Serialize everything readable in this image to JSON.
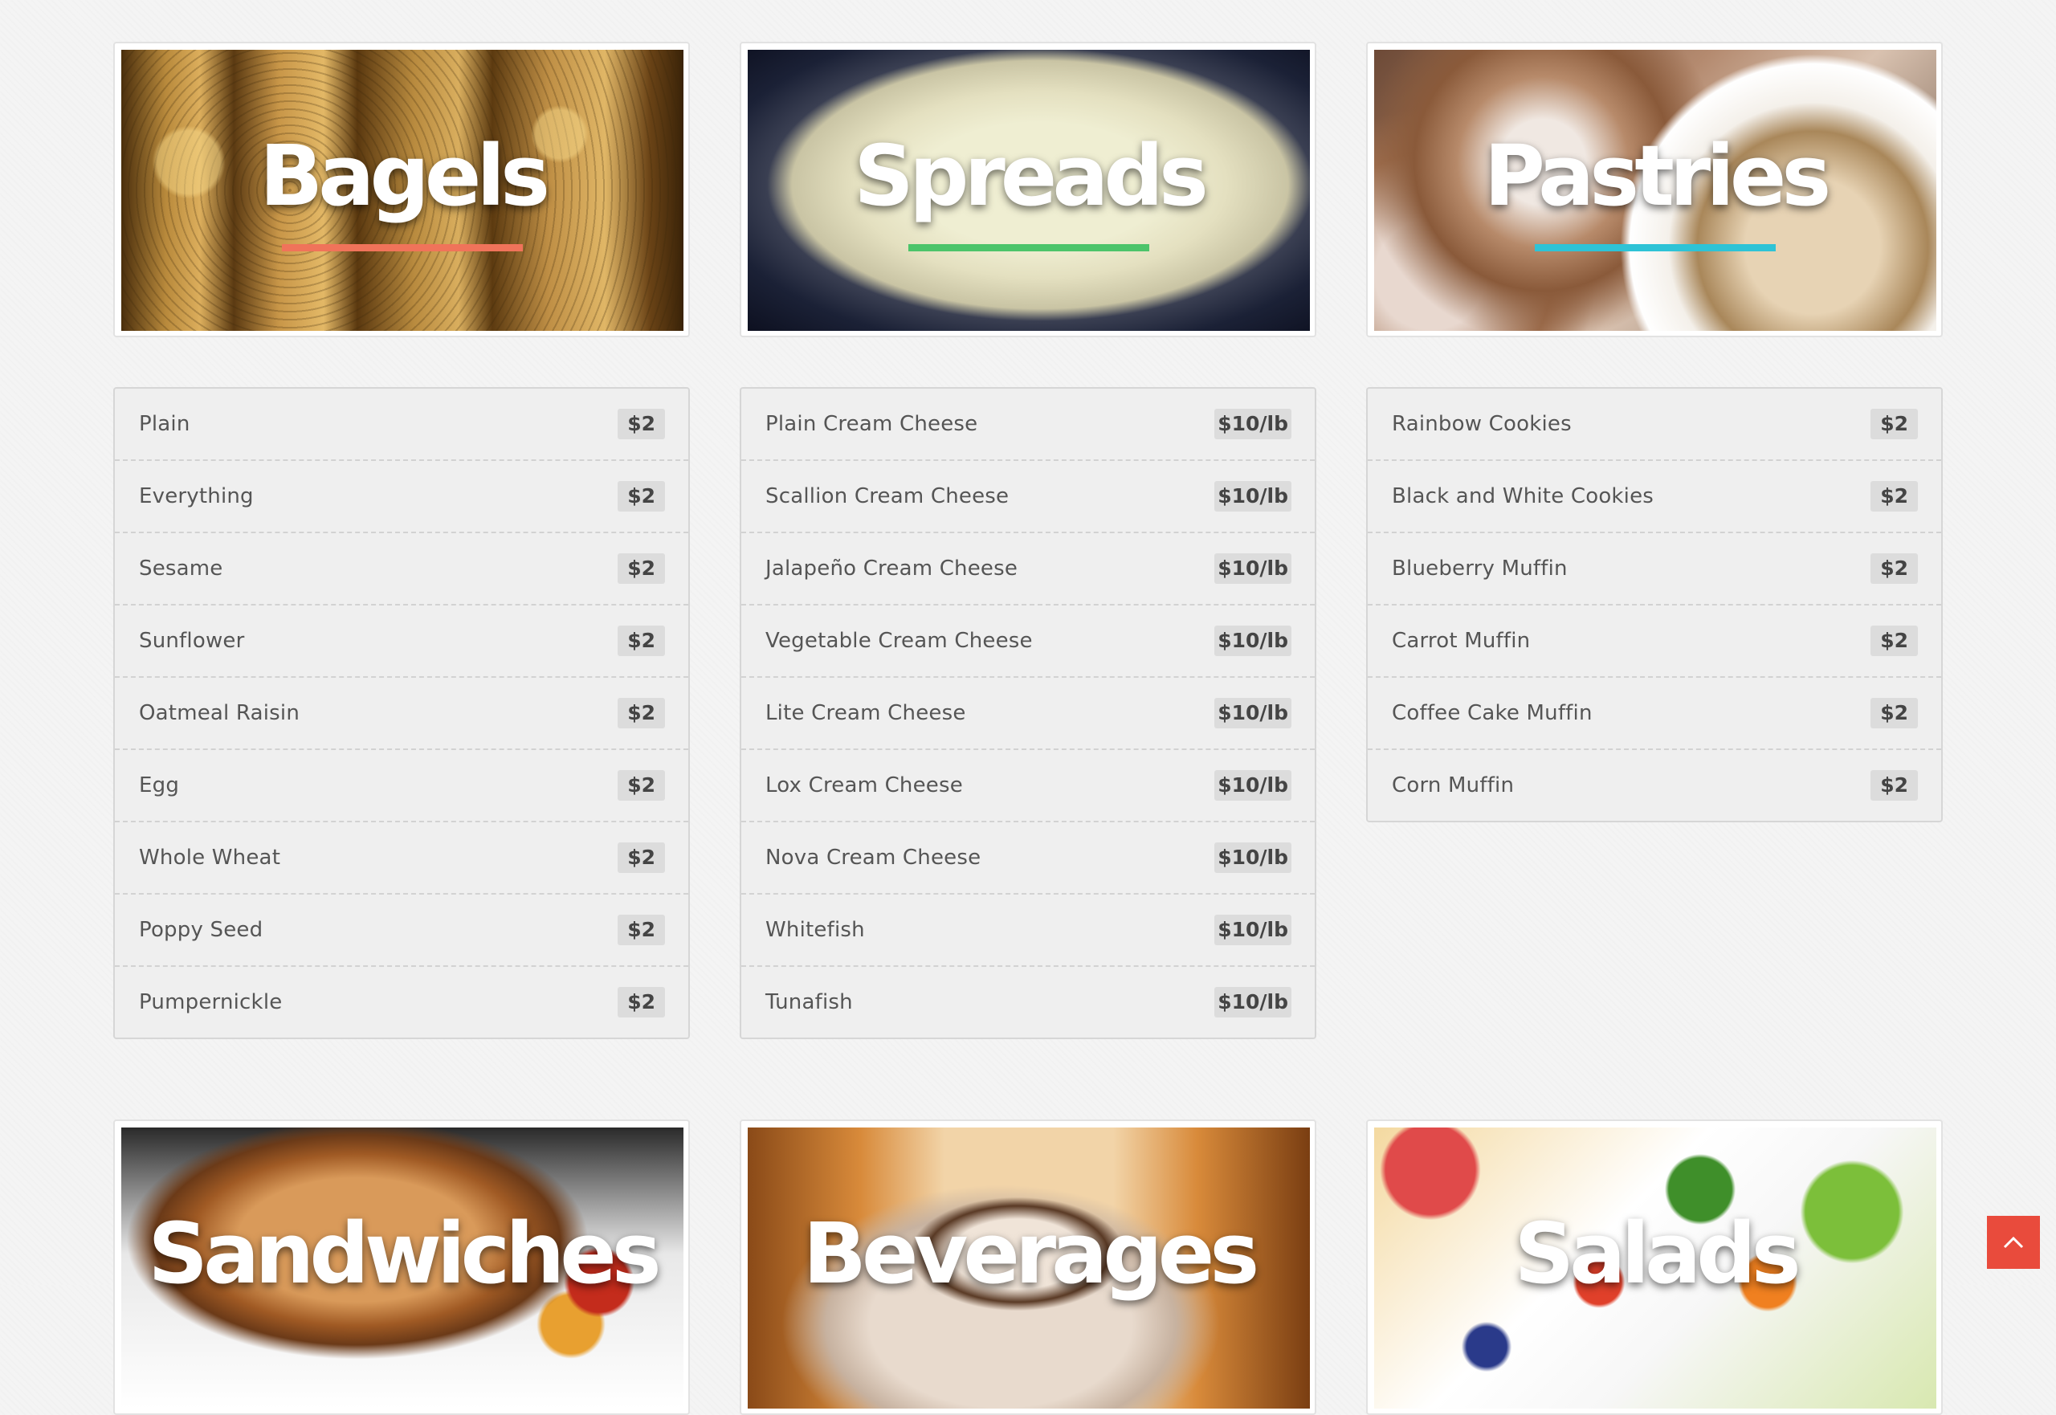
{
  "colors": {
    "bagels_underline": "#f0735a",
    "spreads_underline": "#4cc46a",
    "pastries_underline": "#2ec3d6",
    "scroll_button": "#e94b3c"
  },
  "sections": {
    "bagels": {
      "title": "Bagels",
      "items": [
        {
          "name": "Plain",
          "price": "$2"
        },
        {
          "name": "Everything",
          "price": "$2"
        },
        {
          "name": "Sesame",
          "price": "$2"
        },
        {
          "name": "Sunflower",
          "price": "$2"
        },
        {
          "name": "Oatmeal Raisin",
          "price": "$2"
        },
        {
          "name": "Egg",
          "price": "$2"
        },
        {
          "name": "Whole Wheat",
          "price": "$2"
        },
        {
          "name": "Poppy Seed",
          "price": "$2"
        },
        {
          "name": "Pumpernickle",
          "price": "$2"
        }
      ]
    },
    "spreads": {
      "title": "Spreads",
      "items": [
        {
          "name": "Plain Cream Cheese",
          "price": "$10/lb"
        },
        {
          "name": "Scallion Cream Cheese",
          "price": "$10/lb"
        },
        {
          "name": "Jalapeño Cream Cheese",
          "price": "$10/lb"
        },
        {
          "name": "Vegetable Cream Cheese",
          "price": "$10/lb"
        },
        {
          "name": "Lite Cream Cheese",
          "price": "$10/lb"
        },
        {
          "name": "Lox Cream Cheese",
          "price": "$10/lb"
        },
        {
          "name": "Nova Cream Cheese",
          "price": "$10/lb"
        },
        {
          "name": "Whitefish",
          "price": "$10/lb"
        },
        {
          "name": "Tunafish",
          "price": "$10/lb"
        }
      ]
    },
    "pastries": {
      "title": "Pastries",
      "items": [
        {
          "name": "Rainbow Cookies",
          "price": "$2"
        },
        {
          "name": "Black and White Cookies",
          "price": "$2"
        },
        {
          "name": "Blueberry Muffin",
          "price": "$2"
        },
        {
          "name": "Carrot Muffin",
          "price": "$2"
        },
        {
          "name": "Coffee Cake Muffin",
          "price": "$2"
        },
        {
          "name": "Corn Muffin",
          "price": "$2"
        }
      ]
    },
    "sandwiches": {
      "title": "Sandwiches"
    },
    "beverages": {
      "title": "Beverages"
    },
    "salads": {
      "title": "Salads"
    }
  },
  "scroll_top": {
    "icon": "chevron-up-icon"
  }
}
